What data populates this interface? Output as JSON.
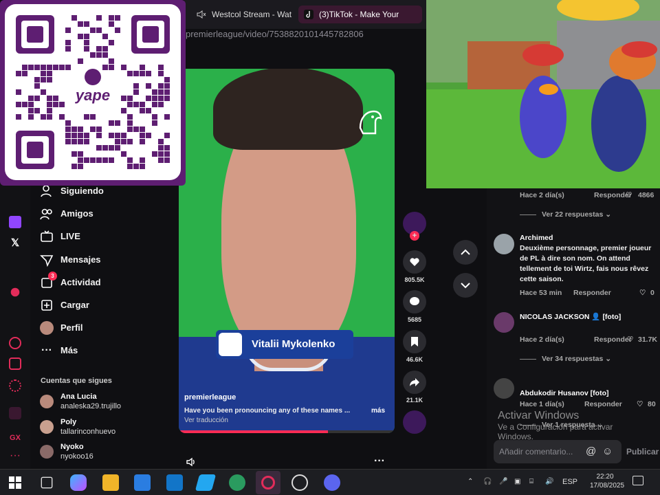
{
  "browser": {
    "tabs": [
      {
        "label": "Westcol Stream - Wat",
        "muted": true
      },
      {
        "label": "(3)TikTok - Make Your",
        "active": true
      }
    ],
    "url": "premierleague/video/7538820101445782806"
  },
  "nav": {
    "items": [
      "Siguiendo",
      "Amigos",
      "LIVE",
      "Mensajes",
      "Actividad",
      "Cargar",
      "Perfil",
      "Más"
    ],
    "activity_badge": "3",
    "following_title": "Cuentas que sigues",
    "following": [
      {
        "name": "Ana Lucia",
        "handle": "analeska29.trujillo"
      },
      {
        "name": "Poly",
        "handle": "tallarinconhuevo"
      },
      {
        "name": "Nyoko",
        "handle": "nyokoo16"
      }
    ]
  },
  "video": {
    "name_plate": "Vitalii Mykolenko",
    "account": "premierleague",
    "description": "Have you been pronouncing any of these names ...",
    "more": "más",
    "translate": "Ver traducción",
    "progress": 0.69
  },
  "actions": {
    "likes": "805.5K",
    "comments": "5685",
    "saves": "46.6K",
    "shares": "21.1K"
  },
  "comments": {
    "top": {
      "time": "Hace 2 día(s)",
      "reply": "Responder",
      "likes": "4866",
      "view_replies": "Ver 22 respuestas"
    },
    "items": [
      {
        "user": "Archimed",
        "text": "Deuxième personnage, premier joueur de PL à dire son nom. On attend tellement de toi Wirtz, fais nous rêvez cette saison.",
        "time": "Hace 53 min",
        "reply": "Responder",
        "likes": "0"
      },
      {
        "user": "NICOLAS JACKSON",
        "tag": "[foto]",
        "time": "Hace 2 día(s)",
        "reply": "Responder",
        "likes": "31.7K",
        "view_replies": "Ver 34 respuestas"
      },
      {
        "user": "Abdukodir Husanov [foto]",
        "time": "Hace 1 día(s)",
        "reply": "Responder",
        "likes": "80",
        "view_replies": "Ver 1 respuesta"
      }
    ],
    "add_placeholder": "Añadir comentario...",
    "publish": "Publicar"
  },
  "watermark": {
    "title": "Activar Windows",
    "subtitle": "Ve a Configuración para activar Windows."
  },
  "taskbar": {
    "lang": "ESP",
    "time": "22:20",
    "date": "17/08/2025"
  },
  "colors": {
    "accent": "#fe2c55",
    "qr_frame": "#5e1e72",
    "background": "#0f0f12"
  }
}
